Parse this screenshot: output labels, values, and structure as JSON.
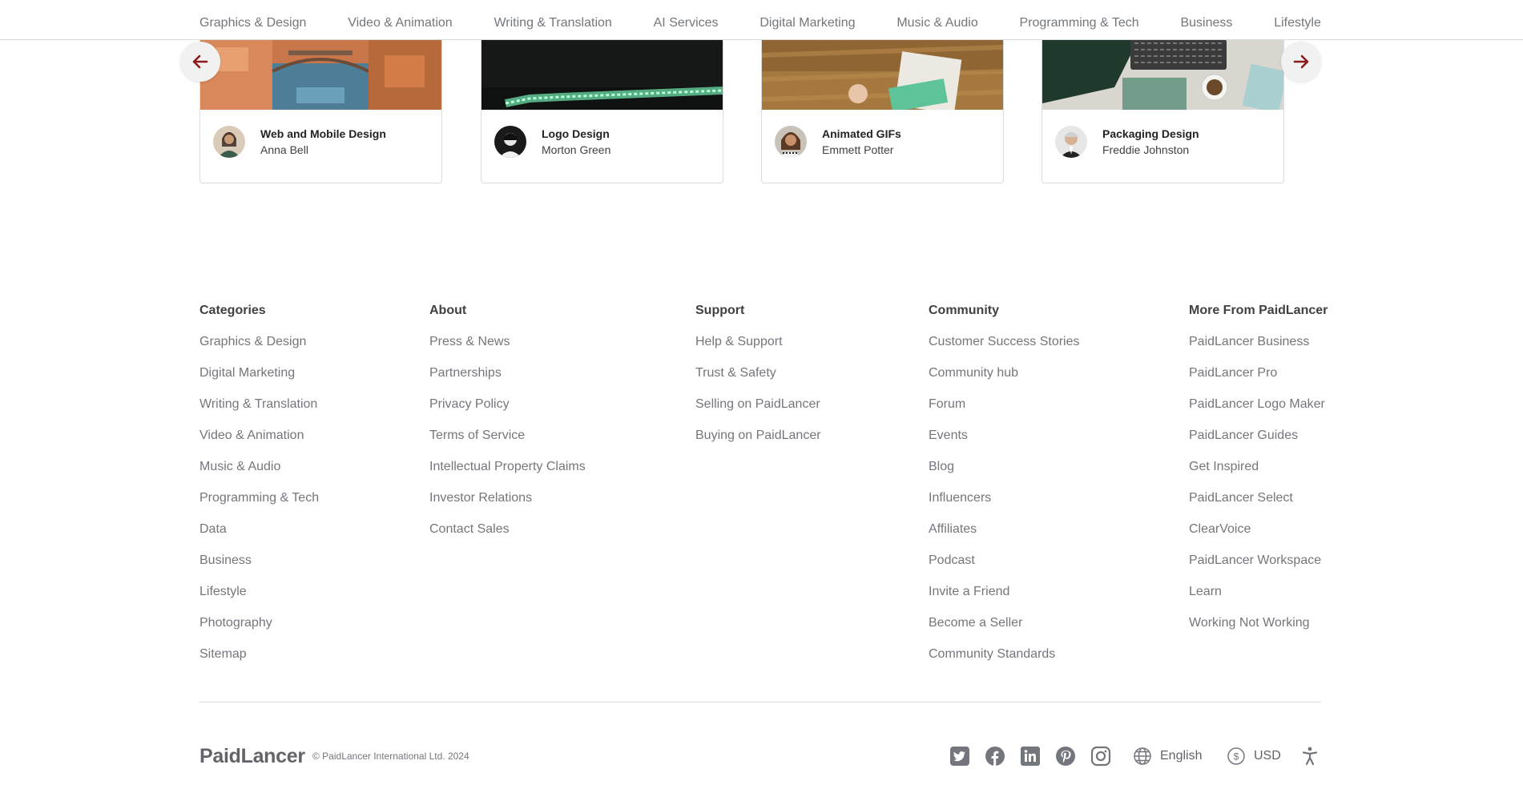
{
  "category_nav": {
    "items": [
      "Graphics & Design",
      "Video & Animation",
      "Writing & Translation",
      "AI Services",
      "Digital Marketing",
      "Music & Audio",
      "Programming & Tech",
      "Business",
      "Lifestyle"
    ]
  },
  "carousel": {
    "prev_icon": "arrow-left-icon",
    "next_icon": "arrow-right-icon",
    "arrow_color": "#8b1a1a",
    "cards": [
      {
        "title": "Web and Mobile Design",
        "author": "Anna Bell"
      },
      {
        "title": "Logo Design",
        "author": "Morton Green"
      },
      {
        "title": "Animated GIFs",
        "author": "Emmett Potter"
      },
      {
        "title": "Packaging Design",
        "author": "Freddie Johnston"
      }
    ]
  },
  "footer": {
    "columns": [
      {
        "heading": "Categories",
        "links": [
          "Graphics & Design",
          "Digital Marketing",
          "Writing & Translation",
          "Video & Animation",
          "Music & Audio",
          "Programming & Tech",
          "Data",
          "Business",
          "Lifestyle",
          "Photography",
          "Sitemap"
        ]
      },
      {
        "heading": "About",
        "links": [
          "Press & News",
          "Partnerships",
          "Privacy Policy",
          "Terms of Service",
          "Intellectual Property Claims",
          "Investor Relations",
          "Contact Sales"
        ]
      },
      {
        "heading": "Support",
        "links": [
          "Help & Support",
          "Trust & Safety",
          "Selling on PaidLancer",
          "Buying on PaidLancer"
        ]
      },
      {
        "heading": "Community",
        "links": [
          "Customer Success Stories",
          "Community hub",
          "Forum",
          "Events",
          "Blog",
          "Influencers",
          "Affiliates",
          "Podcast",
          "Invite a Friend",
          "Become a Seller",
          "Community Standards"
        ]
      },
      {
        "heading": "More From PaidLancer",
        "links": [
          "PaidLancer Business",
          "PaidLancer Pro",
          "PaidLancer Logo Maker",
          "PaidLancer Guides",
          "Get Inspired",
          "PaidLancer Select",
          "ClearVoice",
          "PaidLancer Workspace",
          "Learn",
          "Working Not Working"
        ]
      }
    ],
    "bottom": {
      "logo": "PaidLancer",
      "copyright": "© PaidLancer International Ltd. 2024",
      "social_icons": [
        "twitter-icon",
        "facebook-icon",
        "linkedin-icon",
        "pinterest-icon",
        "instagram-icon"
      ],
      "language": "English",
      "currency": "USD",
      "accessibility_icon": "accessibility-icon"
    }
  }
}
